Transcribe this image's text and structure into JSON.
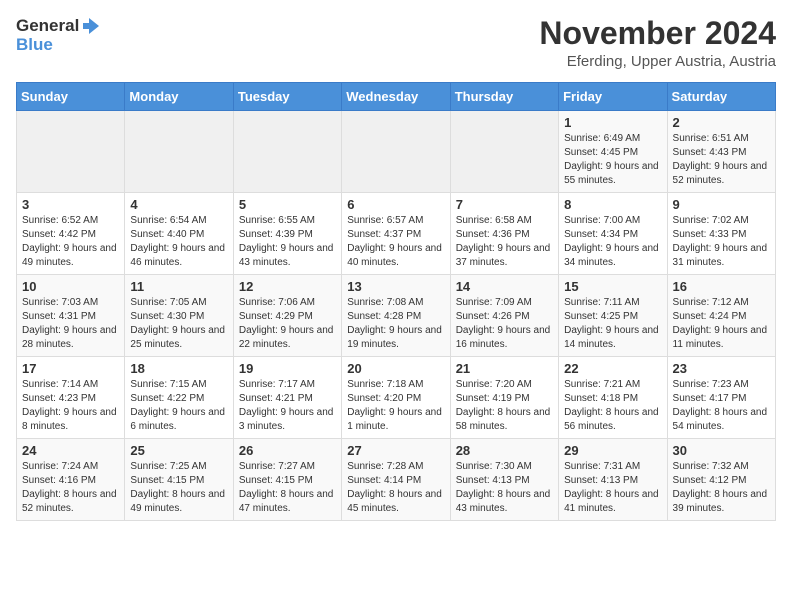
{
  "logo": {
    "general": "General",
    "blue": "Blue"
  },
  "header": {
    "title": "November 2024",
    "subtitle": "Eferding, Upper Austria, Austria"
  },
  "weekdays": [
    "Sunday",
    "Monday",
    "Tuesday",
    "Wednesday",
    "Thursday",
    "Friday",
    "Saturday"
  ],
  "weeks": [
    [
      {
        "day": "",
        "info": ""
      },
      {
        "day": "",
        "info": ""
      },
      {
        "day": "",
        "info": ""
      },
      {
        "day": "",
        "info": ""
      },
      {
        "day": "",
        "info": ""
      },
      {
        "day": "1",
        "info": "Sunrise: 6:49 AM\nSunset: 4:45 PM\nDaylight: 9 hours and 55 minutes."
      },
      {
        "day": "2",
        "info": "Sunrise: 6:51 AM\nSunset: 4:43 PM\nDaylight: 9 hours and 52 minutes."
      }
    ],
    [
      {
        "day": "3",
        "info": "Sunrise: 6:52 AM\nSunset: 4:42 PM\nDaylight: 9 hours and 49 minutes."
      },
      {
        "day": "4",
        "info": "Sunrise: 6:54 AM\nSunset: 4:40 PM\nDaylight: 9 hours and 46 minutes."
      },
      {
        "day": "5",
        "info": "Sunrise: 6:55 AM\nSunset: 4:39 PM\nDaylight: 9 hours and 43 minutes."
      },
      {
        "day": "6",
        "info": "Sunrise: 6:57 AM\nSunset: 4:37 PM\nDaylight: 9 hours and 40 minutes."
      },
      {
        "day": "7",
        "info": "Sunrise: 6:58 AM\nSunset: 4:36 PM\nDaylight: 9 hours and 37 minutes."
      },
      {
        "day": "8",
        "info": "Sunrise: 7:00 AM\nSunset: 4:34 PM\nDaylight: 9 hours and 34 minutes."
      },
      {
        "day": "9",
        "info": "Sunrise: 7:02 AM\nSunset: 4:33 PM\nDaylight: 9 hours and 31 minutes."
      }
    ],
    [
      {
        "day": "10",
        "info": "Sunrise: 7:03 AM\nSunset: 4:31 PM\nDaylight: 9 hours and 28 minutes."
      },
      {
        "day": "11",
        "info": "Sunrise: 7:05 AM\nSunset: 4:30 PM\nDaylight: 9 hours and 25 minutes."
      },
      {
        "day": "12",
        "info": "Sunrise: 7:06 AM\nSunset: 4:29 PM\nDaylight: 9 hours and 22 minutes."
      },
      {
        "day": "13",
        "info": "Sunrise: 7:08 AM\nSunset: 4:28 PM\nDaylight: 9 hours and 19 minutes."
      },
      {
        "day": "14",
        "info": "Sunrise: 7:09 AM\nSunset: 4:26 PM\nDaylight: 9 hours and 16 minutes."
      },
      {
        "day": "15",
        "info": "Sunrise: 7:11 AM\nSunset: 4:25 PM\nDaylight: 9 hours and 14 minutes."
      },
      {
        "day": "16",
        "info": "Sunrise: 7:12 AM\nSunset: 4:24 PM\nDaylight: 9 hours and 11 minutes."
      }
    ],
    [
      {
        "day": "17",
        "info": "Sunrise: 7:14 AM\nSunset: 4:23 PM\nDaylight: 9 hours and 8 minutes."
      },
      {
        "day": "18",
        "info": "Sunrise: 7:15 AM\nSunset: 4:22 PM\nDaylight: 9 hours and 6 minutes."
      },
      {
        "day": "19",
        "info": "Sunrise: 7:17 AM\nSunset: 4:21 PM\nDaylight: 9 hours and 3 minutes."
      },
      {
        "day": "20",
        "info": "Sunrise: 7:18 AM\nSunset: 4:20 PM\nDaylight: 9 hours and 1 minute."
      },
      {
        "day": "21",
        "info": "Sunrise: 7:20 AM\nSunset: 4:19 PM\nDaylight: 8 hours and 58 minutes."
      },
      {
        "day": "22",
        "info": "Sunrise: 7:21 AM\nSunset: 4:18 PM\nDaylight: 8 hours and 56 minutes."
      },
      {
        "day": "23",
        "info": "Sunrise: 7:23 AM\nSunset: 4:17 PM\nDaylight: 8 hours and 54 minutes."
      }
    ],
    [
      {
        "day": "24",
        "info": "Sunrise: 7:24 AM\nSunset: 4:16 PM\nDaylight: 8 hours and 52 minutes."
      },
      {
        "day": "25",
        "info": "Sunrise: 7:25 AM\nSunset: 4:15 PM\nDaylight: 8 hours and 49 minutes."
      },
      {
        "day": "26",
        "info": "Sunrise: 7:27 AM\nSunset: 4:15 PM\nDaylight: 8 hours and 47 minutes."
      },
      {
        "day": "27",
        "info": "Sunrise: 7:28 AM\nSunset: 4:14 PM\nDaylight: 8 hours and 45 minutes."
      },
      {
        "day": "28",
        "info": "Sunrise: 7:30 AM\nSunset: 4:13 PM\nDaylight: 8 hours and 43 minutes."
      },
      {
        "day": "29",
        "info": "Sunrise: 7:31 AM\nSunset: 4:13 PM\nDaylight: 8 hours and 41 minutes."
      },
      {
        "day": "30",
        "info": "Sunrise: 7:32 AM\nSunset: 4:12 PM\nDaylight: 8 hours and 39 minutes."
      }
    ]
  ]
}
